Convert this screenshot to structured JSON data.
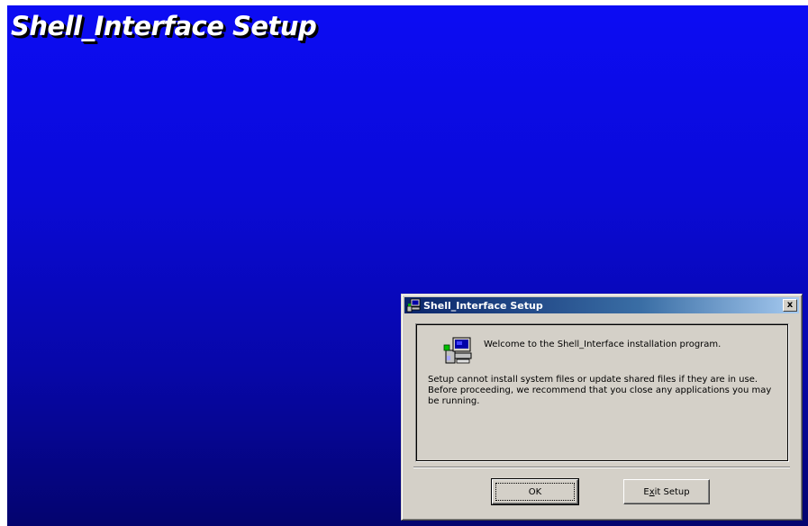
{
  "background": {
    "title": "Shell_Interface Setup"
  },
  "dialog": {
    "title": "Shell_Interface Setup",
    "close_label": "x",
    "welcome": "Welcome to the Shell_Interface installation program.",
    "warning": "Setup cannot install system files or update shared files if they are in use. Before proceeding, we recommend that you close any applications you may be running.",
    "buttons": {
      "ok": "OK",
      "exit_prefix": "E",
      "exit_mnemonic": "x",
      "exit_suffix": "it Setup"
    }
  },
  "icons": {
    "titlebar": "setup-computer-icon",
    "content": "setup-computer-icon",
    "close": "close-icon"
  },
  "colors": {
    "background_top": "#0c0cf4",
    "background_bottom": "#04046e",
    "titlebar_start": "#0a246a",
    "titlebar_end": "#a6caf0",
    "dialog_face": "#d4d0c8"
  }
}
